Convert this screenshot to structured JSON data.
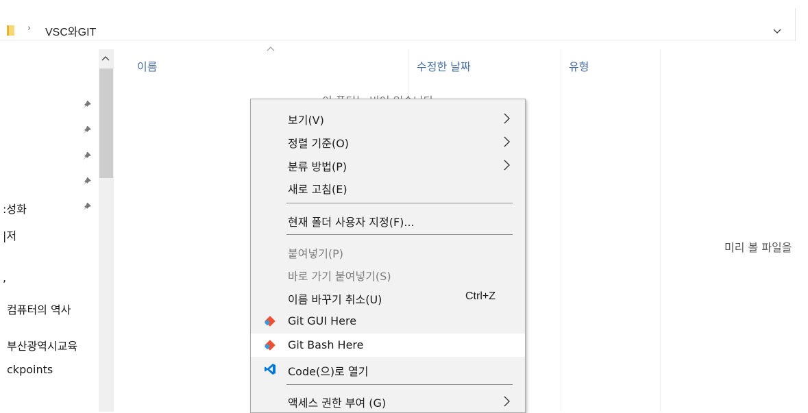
{
  "address_bar": {
    "separator": "›",
    "path": "VSC와GIT",
    "dropdown_icon": "chevron-down-icon"
  },
  "nav_pane": {
    "items": [
      {
        "label": "성화",
        "glyph": ":"
      },
      {
        "label": "저",
        "glyph": "|"
      },
      {
        "label": ","
      },
      {
        "label": "컴퓨터의 역사"
      },
      {
        "label": "부산광역시교육"
      },
      {
        "label": "ckpoints"
      }
    ]
  },
  "columns": {
    "name": "이름",
    "modified": "수정한 날짜",
    "type": "유형"
  },
  "empty_message": "이 폴더는 비어 있습니다.",
  "preview": "미리 볼 파일을",
  "context_menu": {
    "items": [
      {
        "label": "보기(V)"
      },
      {
        "label": "정렬 기준(O)"
      },
      {
        "label": "분류 방법(P)"
      },
      {
        "label": "새로 고침(E)"
      },
      {
        "label": "현재 폴더 사용자 지정(F)..."
      },
      {
        "label": "붙여넣기(P)"
      },
      {
        "label": "바로 가기 붙여넣기(S)"
      },
      {
        "label": "이름 바꾸기 취소(U)",
        "shortcut": "Ctrl+Z"
      },
      {
        "label": "Git GUI Here"
      },
      {
        "label": "Git Bash Here"
      },
      {
        "label": "Code(으)로 열기"
      },
      {
        "label": "액세스 권한 부여 (G)"
      }
    ]
  },
  "colors": {
    "git_orange": "#f05032",
    "vscode_blue": "#0078d7",
    "header_text": "#4a6fa5"
  }
}
